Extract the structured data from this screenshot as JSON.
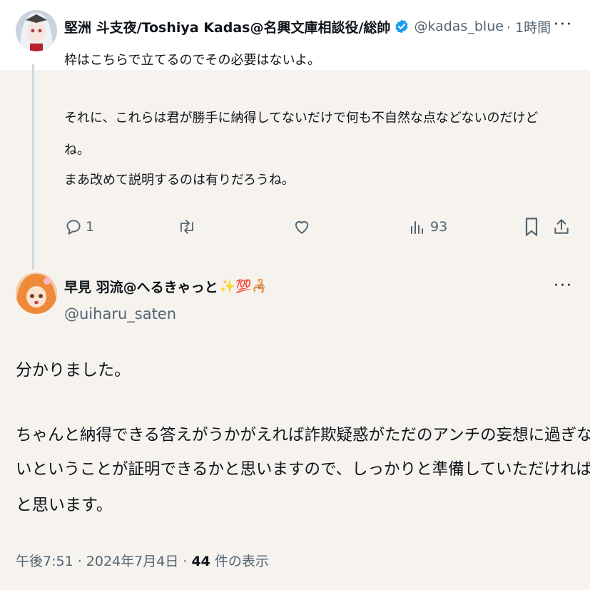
{
  "reply_tweet": {
    "display_name": "堅洲 斗支夜/Toshiya Kadas@名興文庫相談役/総帥",
    "handle": "@kadas_blue",
    "time": "· 1時間",
    "more": "···",
    "lines": [
      "枠はこちらで立てるのでその必要はないよ。",
      "それに、これらは君が勝手に納得してないだけで何も不自然な点などないのだけど",
      "ね。",
      "まあ改めて説明するのは有りだろうね。"
    ],
    "actions": {
      "replies": "1",
      "views": "93"
    }
  },
  "main_tweet": {
    "display_name": "早見 羽流@へるきゃっと",
    "name_emoji": "✨💯🦂",
    "handle": "@uiharu_saten",
    "more": "···",
    "lines": [
      "分かりました。",
      "ちゃんと納得できる答えがうかがえれば詐欺疑惑がただのアンチの妄想に過ぎな",
      "いということが証明できるかと思いますので、しっかりと準備していただければ",
      "と思います。"
    ],
    "timestamp": "午後7:51 · 2024年7月4日 · ",
    "view_count": "44",
    "view_label": " 件の表示"
  },
  "colors": {
    "verified": "#1d9bf0",
    "muted": "#536471",
    "text": "#0f1419",
    "line": "#cfd9de"
  },
  "icons": [
    "reply-icon",
    "retweet-icon",
    "like-icon",
    "views-icon",
    "bookmark-icon",
    "share-icon",
    "verified-badge-icon",
    "more-icon"
  ]
}
